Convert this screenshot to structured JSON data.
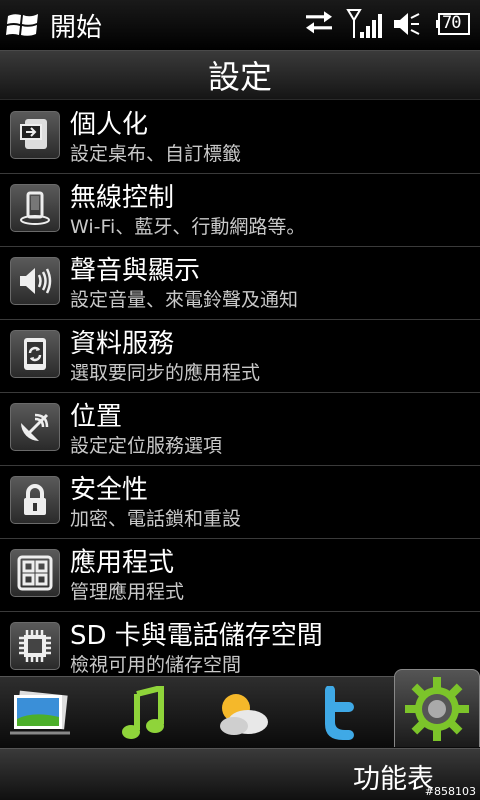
{
  "status_bar": {
    "start_label": "開始",
    "battery_level": "70",
    "icons": [
      "windows-flag-icon",
      "data-transfer-icon",
      "signal-icon",
      "mute-icon",
      "battery-icon"
    ]
  },
  "title": "設定",
  "settings": [
    {
      "title": "個人化",
      "subtitle": "設定桌布、自訂標籤",
      "icon": "personalize-icon"
    },
    {
      "title": "無線控制",
      "subtitle": "Wi-Fi、藍牙、行動網路等。",
      "icon": "wireless-icon"
    },
    {
      "title": "聲音與顯示",
      "subtitle": "設定音量、來電鈴聲及通知",
      "icon": "speaker-icon"
    },
    {
      "title": "資料服務",
      "subtitle": "選取要同步的應用程式",
      "icon": "sync-icon"
    },
    {
      "title": "位置",
      "subtitle": "設定定位服務選項",
      "icon": "satellite-icon"
    },
    {
      "title": "安全性",
      "subtitle": "加密、電話鎖和重設",
      "icon": "lock-icon"
    },
    {
      "title": "應用程式",
      "subtitle": "管理應用程式",
      "icon": "apps-grid-icon"
    },
    {
      "title": "SD 卡與電話儲存空間",
      "subtitle": "檢視可用的儲存空間",
      "icon": "chip-icon"
    }
  ],
  "tabs": [
    {
      "icon": "photos-icon",
      "active": false
    },
    {
      "icon": "music-icon",
      "active": false
    },
    {
      "icon": "weather-icon",
      "active": false
    },
    {
      "icon": "twitter-icon",
      "active": false
    },
    {
      "icon": "settings-gear-icon",
      "active": true
    }
  ],
  "softkey": {
    "menu_label": "功能表"
  },
  "watermark": "#858103",
  "colors": {
    "background": "#000000",
    "text": "#ffffff",
    "subtitle": "#c8c8c8",
    "divider": "#3a3a3a"
  }
}
